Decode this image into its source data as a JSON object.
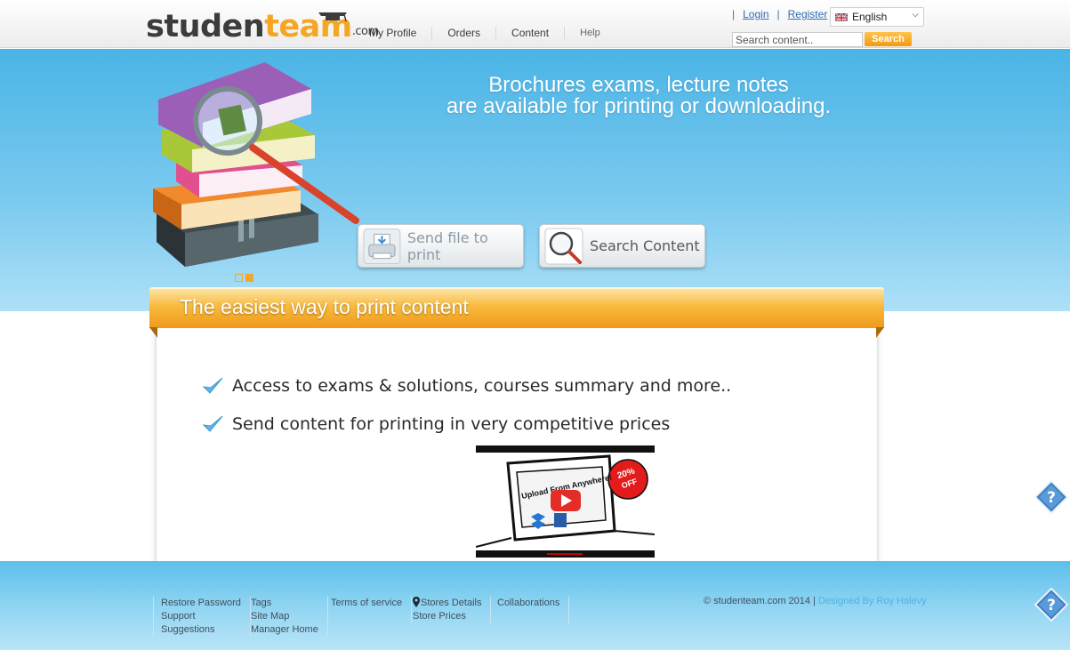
{
  "header": {
    "logo": {
      "part1": "studen",
      "part2": "team",
      "suffix": ".com"
    },
    "nav": [
      {
        "label": "My Profile"
      },
      {
        "label": "Orders"
      },
      {
        "label": "Content"
      },
      {
        "label": "Help"
      }
    ],
    "login_label": "Login",
    "register_label": "Register",
    "language": "English",
    "search": {
      "placeholder": "Search content..",
      "button_label": "Search"
    }
  },
  "hero": {
    "headline_line1": "Brochures exams, lecture notes",
    "headline_line2": "are available for printing or downloading.",
    "send_button_label": "Send file to print",
    "search_button_label": "Search Content",
    "slide_count": 2,
    "active_slide": 2
  },
  "main": {
    "ribbon_title": "The easiest way to print content",
    "features": [
      "Access to exams & solutions, courses summary and more..",
      "Send content for printing in very competitive prices"
    ],
    "video": {
      "headline": "Upload From Anywhere!",
      "badge": "20% OFF"
    }
  },
  "footer": {
    "col1": [
      "Restore Password",
      "Support",
      "Suggestions"
    ],
    "col2": [
      "Tags",
      "Site Map",
      "Manager Home"
    ],
    "col3": [
      "Terms of service"
    ],
    "col4": [
      "Stores Details",
      "Store Prices"
    ],
    "col5": [
      "Collaborations"
    ],
    "copyright": "© studenteam.com 2014 |",
    "designer": "Designed By Roy Halevy"
  },
  "colors": {
    "accent_orange": "#f5a623",
    "hero_blue": "#4ab4e6",
    "link_blue": "#2f6bb2"
  },
  "icons": [
    "graduation-cap-icon",
    "uk-flag-icon",
    "chevron-down-icon",
    "printer-icon",
    "magnifier-icon",
    "check-icon",
    "map-pin-icon",
    "help-question-icon",
    "youtube-play-icon"
  ]
}
